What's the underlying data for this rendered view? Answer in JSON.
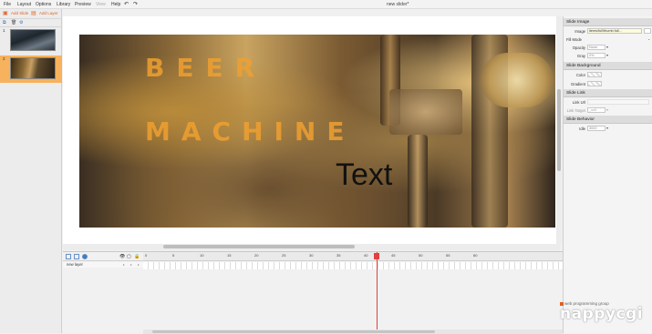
{
  "menubar": {
    "items": [
      "File",
      "Layout",
      "Options",
      "Library",
      "Preview",
      "View",
      "Help"
    ],
    "title": "new slider*"
  },
  "left_panel": {
    "add_slide": "Add Slide",
    "add_layer": "Add Layer",
    "slides": [
      {
        "number": "1"
      },
      {
        "number": "2"
      }
    ]
  },
  "stage": {
    "headline_1": "BEER",
    "headline_2": "MACHINE",
    "text_layer": "Text"
  },
  "properties": {
    "slide_image": {
      "header": "Slide Image",
      "image_label": "Image",
      "image_value": "items/full/thumb.full...",
      "fill_mode_label": "Fill Mode",
      "opacity_label": "Opacity",
      "opacity_value": "None",
      "gray_label": "Gray",
      "gray_value": "0%"
    },
    "slide_background": {
      "header": "Slide Background",
      "color_label": "Color",
      "gradient_label": "Gradient"
    },
    "slide_link": {
      "header": "Slide Link",
      "link_url_label": "Link Url",
      "link_target_label": "Link Target",
      "link_target_value": "_self"
    },
    "slide_behavior": {
      "header": "Slide Behavior",
      "idle_label": "Idle",
      "idle_value": "3000"
    }
  },
  "timeline": {
    "layer_name": "new layer",
    "ticks": [
      "0",
      "5",
      "10",
      "15",
      "20",
      "25",
      "30",
      "35",
      "40",
      "45",
      "50",
      "55",
      "60"
    ]
  },
  "watermark": {
    "tagline": "web programming group",
    "logo": "nappycgi"
  },
  "colors": {
    "accent": "#f6b25d",
    "headline": "#f0a030",
    "playhead": "#e04040"
  }
}
